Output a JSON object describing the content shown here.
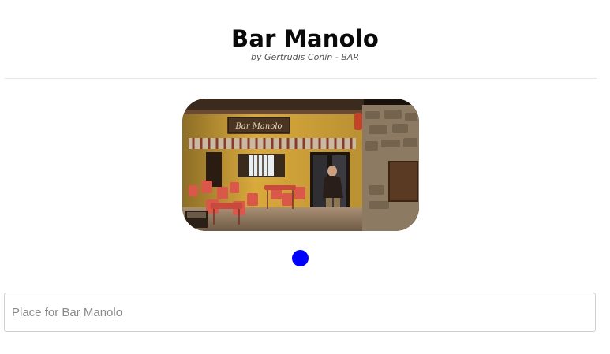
{
  "header": {
    "title": "Bar Manolo",
    "subtitle": "by Gertrudis Coñín - BAR"
  },
  "photo": {
    "icon": "bar-storefront-photo",
    "sign_text": "Bar Manolo"
  },
  "carousel": {
    "active_dot_color": "#0000ff"
  },
  "place_input": {
    "placeholder": "Place for Bar Manolo",
    "value": ""
  }
}
